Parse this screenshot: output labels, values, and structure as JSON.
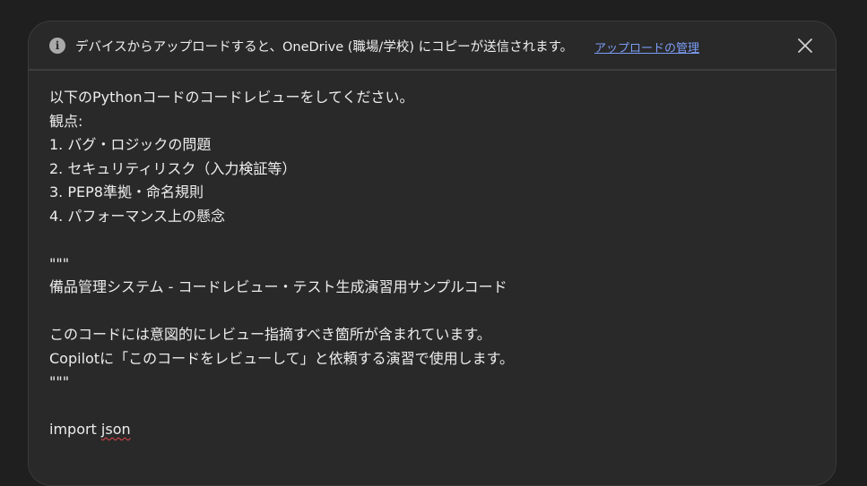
{
  "notice": {
    "icon": "info-icon",
    "text": "デバイスからアップロードすると、OneDrive (職場/学校) にコピーが送信されます。",
    "link": "アップロードの管理",
    "close_icon": "close-icon"
  },
  "prompt": {
    "lines": [
      "以下のPythonコードのコードレビューをしてください。",
      "観点:",
      "1. バグ・ロジックの問題",
      "2. セキュリティリスク（入力検証等）",
      "3. PEP8準拠・命名規則",
      "4. パフォーマンス上の懸念",
      "",
      "\"\"\"",
      "備品管理システム - コードレビュー・テスト生成演習用サンプルコード",
      "",
      "このコードには意図的にレビュー指摘すべき箇所が含まれています。",
      "Copilotに「このコードをレビューして」と依頼する演習で使用します。",
      "\"\"\"",
      ""
    ],
    "import_keyword": "import",
    "import_module": "json"
  }
}
